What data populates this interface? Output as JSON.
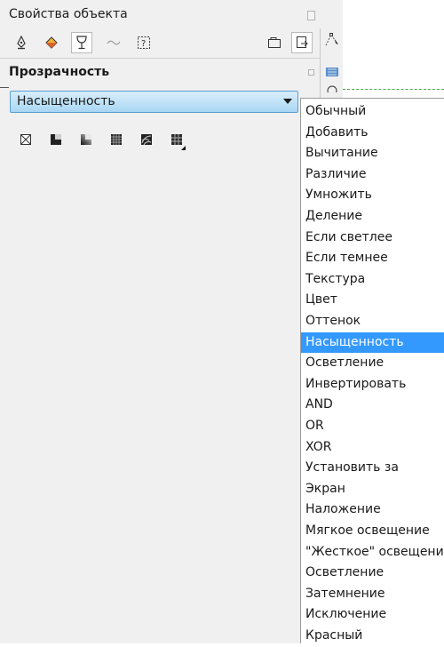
{
  "panel": {
    "title": "Свойства объекта",
    "tabs": [
      {
        "icon": "pen-outline-icon"
      },
      {
        "icon": "fill-bucket-icon"
      },
      {
        "icon": "transparency-glass-icon",
        "selected": true
      },
      {
        "icon": "curve-wave-icon"
      },
      {
        "icon": "text-frame-icon"
      },
      {
        "icon": "frame-icon"
      },
      {
        "icon": "export-page-icon"
      }
    ],
    "section_title": "Прозрачность"
  },
  "blend_select": {
    "value": "Насыщенность",
    "options": [
      "Обычный",
      "Добавить",
      "Вычитание",
      "Различие",
      "Умножить",
      "Деление",
      "Если светлее",
      "Если темнее",
      "Текстура",
      "Цвет",
      "Оттенок",
      "Насыщенность",
      "Осветление",
      "Инвертировать",
      "AND",
      "OR",
      "XOR",
      "Установить за",
      "Экран",
      "Наложение",
      "Мягкое освещение",
      "\"Жесткое\" освещение",
      "Осветление",
      "Затемнение",
      "Исключение",
      "Красный"
    ],
    "selected_index": 11
  },
  "transparency_modes": [
    {
      "icon": "no-transparency-icon"
    },
    {
      "icon": "uniform-transparency-icon"
    },
    {
      "icon": "fountain-transparency-icon"
    },
    {
      "icon": "pattern-transparency-icon"
    },
    {
      "icon": "texture-transparency-icon"
    },
    {
      "icon": "two-color-pattern-transparency-icon"
    }
  ],
  "colors": {
    "accent": "#3399ff",
    "select_top": "#d9eefb",
    "select_bottom": "#a9d6f3"
  }
}
